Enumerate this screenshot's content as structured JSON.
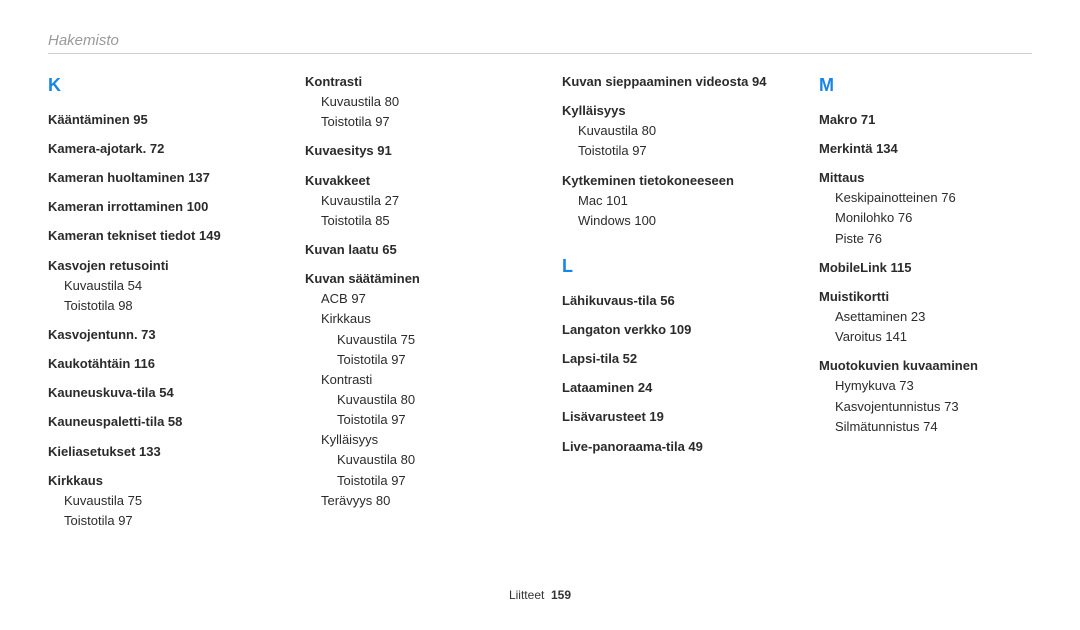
{
  "header": "Hakemisto",
  "footer": {
    "label": "Liitteet",
    "page": "159"
  },
  "col1": {
    "letter": "K",
    "entries": [
      {
        "text": "Kääntäminen  95",
        "bold": true
      },
      {
        "text": "Kamera-ajotark.  72",
        "bold": true
      },
      {
        "text": "Kameran huoltaminen  137",
        "bold": true
      },
      {
        "text": "Kameran irrottaminen  100",
        "bold": true
      },
      {
        "text": "Kameran tekniset tiedot  149",
        "bold": true
      },
      {
        "text": "Kasvojen retusointi",
        "bold": true
      },
      {
        "text": "Kuvaustila  54",
        "sub": 1
      },
      {
        "text": "Toistotila  98",
        "sub": 1
      },
      {
        "text": "Kasvojentunn.  73",
        "bold": true
      },
      {
        "text": "Kaukotähtäin  116",
        "bold": true
      },
      {
        "text": "Kauneuskuva-tila  54",
        "bold": true
      },
      {
        "text": "Kauneuspaletti-tila  58",
        "bold": true
      },
      {
        "text": "Kieliasetukset  133",
        "bold": true
      },
      {
        "text": "Kirkkaus",
        "bold": true
      },
      {
        "text": "Kuvaustila  75",
        "sub": 1
      },
      {
        "text": "Toistotila  97",
        "sub": 1
      }
    ]
  },
  "col2": {
    "entries": [
      {
        "text": "Kontrasti",
        "bold": true
      },
      {
        "text": "Kuvaustila  80",
        "sub": 1
      },
      {
        "text": "Toistotila  97",
        "sub": 1
      },
      {
        "text": "Kuvaesitys  91",
        "bold": true
      },
      {
        "text": "Kuvakkeet",
        "bold": true
      },
      {
        "text": "Kuvaustila  27",
        "sub": 1
      },
      {
        "text": "Toistotila  85",
        "sub": 1
      },
      {
        "text": "Kuvan laatu  65",
        "bold": true
      },
      {
        "text": "Kuvan säätäminen",
        "bold": true
      },
      {
        "text": "ACB  97",
        "sub": 1
      },
      {
        "text": "Kirkkaus",
        "sub": 1
      },
      {
        "text": "Kuvaustila  75",
        "sub": 2
      },
      {
        "text": "Toistotila  97",
        "sub": 2
      },
      {
        "text": "Kontrasti",
        "sub": 1
      },
      {
        "text": "Kuvaustila  80",
        "sub": 2
      },
      {
        "text": "Toistotila  97",
        "sub": 2
      },
      {
        "text": "Kylläisyys",
        "sub": 1
      },
      {
        "text": "Kuvaustila  80",
        "sub": 2
      },
      {
        "text": "Toistotila  97",
        "sub": 2
      },
      {
        "text": "Terävyys  80",
        "sub": 1
      }
    ]
  },
  "col3": {
    "letter": "L",
    "precont": [
      {
        "text": "Kuvan sieppaaminen videosta  94",
        "bold": true
      },
      {
        "text": "Kylläisyys",
        "bold": true
      },
      {
        "text": "Kuvaustila  80",
        "sub": 1
      },
      {
        "text": "Toistotila  97",
        "sub": 1
      },
      {
        "text": "Kytkeminen tietokoneeseen",
        "bold": true
      },
      {
        "text": "Mac  101",
        "sub": 1
      },
      {
        "text": "Windows  100",
        "sub": 1
      }
    ],
    "entries": [
      {
        "text": "Lähikuvaus-tila  56",
        "bold": true
      },
      {
        "text": "Langaton verkko  109",
        "bold": true
      },
      {
        "text": "Lapsi-tila  52",
        "bold": true
      },
      {
        "text": "Lataaminen  24",
        "bold": true
      },
      {
        "text": "Lisävarusteet  19",
        "bold": true
      },
      {
        "text": "Live-panoraama-tila  49",
        "bold": true
      }
    ]
  },
  "col4": {
    "letter": "M",
    "entries": [
      {
        "text": "Makro  71",
        "bold": true
      },
      {
        "text": "Merkintä  134",
        "bold": true
      },
      {
        "text": "Mittaus",
        "bold": true
      },
      {
        "text": "Keskipainotteinen  76",
        "sub": 1
      },
      {
        "text": "Monilohko  76",
        "sub": 1
      },
      {
        "text": "Piste  76",
        "sub": 1
      },
      {
        "text": "MobileLink  115",
        "bold": true
      },
      {
        "text": "Muistikortti",
        "bold": true
      },
      {
        "text": "Asettaminen  23",
        "sub": 1
      },
      {
        "text": "Varoitus  141",
        "sub": 1
      },
      {
        "text": "Muotokuvien kuvaaminen",
        "bold": true
      },
      {
        "text": "Hymykuva  73",
        "sub": 1
      },
      {
        "text": "Kasvojentunnistus  73",
        "sub": 1
      },
      {
        "text": "Silmätunnistus  74",
        "sub": 1
      }
    ]
  }
}
